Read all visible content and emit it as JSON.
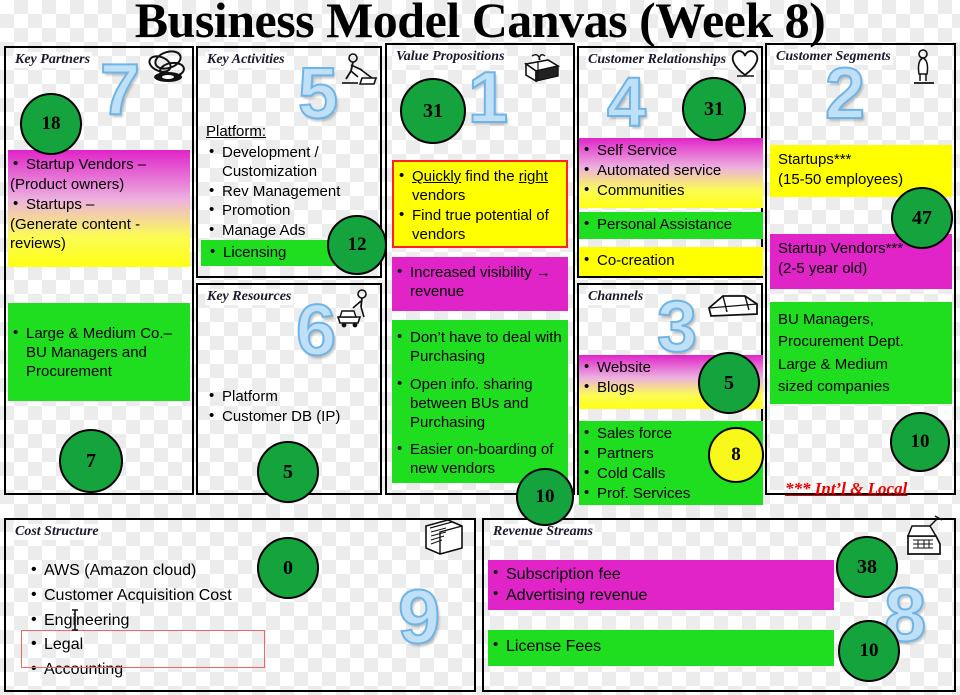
{
  "page": {
    "title": "Business Model Canvas (Week 8)"
  },
  "palette": {
    "green_note": "#1fdd1f",
    "yellow_note": "#ffff00",
    "magenta_note": "#e024c8",
    "bubble_green": "#14a33c",
    "bubble_yellow": "#f7f719",
    "step_number": "#bfe0f7",
    "step_number_outline": "#6fb4e8",
    "annotation_red": "#ff2020",
    "footnote_red": "#ee0000"
  },
  "blocks": {
    "key_partners": {
      "title": "Key Partners",
      "step": "7",
      "icon": "chain-links-icon",
      "bubbles": [
        "18",
        "7"
      ],
      "notes": [
        {
          "style": "gradient-magenta-yellow",
          "items": [
            "Startup Vendors –",
            "(Product owners)",
            "Startups –",
            "(Generate content - reviews)"
          ]
        },
        {
          "style": "green",
          "items": [
            "Large & Medium Co.– BU Managers and Procurement"
          ]
        }
      ]
    },
    "key_activities": {
      "title": "Key Activities",
      "step": "5",
      "icon": "worker-sweeping-icon",
      "bubbles": [
        "12"
      ],
      "heading": "Platform:",
      "items": [
        "Development / Customization",
        "Rev Management",
        "Promotion",
        "Manage Ads",
        "Licensing"
      ],
      "highlighted_item": "Licensing"
    },
    "key_resources": {
      "title": "Key Resources",
      "step": "6",
      "icon": "worker-cart-icon",
      "bubbles": [
        "5"
      ],
      "items": [
        "Platform",
        "Customer DB (IP)"
      ]
    },
    "value_propositions": {
      "title": "Value Propositions",
      "step": "1",
      "icon": "gift-box-icon",
      "bubbles": [
        "31",
        "10"
      ],
      "notes": [
        {
          "style": "yellow-red-outline",
          "items": [
            "Quickly find the right vendors",
            "Find true potential of vendors"
          ],
          "underlined": [
            "Quickly",
            "right"
          ]
        },
        {
          "style": "magenta",
          "items": [
            "Increased visibility → revenue"
          ]
        },
        {
          "style": "green",
          "items": [
            "Don’t have to deal with Purchasing",
            "Open info. sharing between BUs and Purchasing",
            "Easier on-boarding of new vendors"
          ]
        }
      ]
    },
    "customer_relationships": {
      "title": "Customer Relationships",
      "step": "4",
      "icon": "heart-icon",
      "bubbles": [
        "31"
      ],
      "notes": [
        {
          "style": "gradient-magenta-yellow",
          "items": [
            "Self Service",
            "Automated service",
            "Communities"
          ]
        },
        {
          "style": "green",
          "items": [
            "Personal Assistance"
          ]
        },
        {
          "style": "yellow",
          "items": [
            "Co-creation"
          ]
        }
      ]
    },
    "channels": {
      "title": "Channels",
      "step": "3",
      "icon": "delivery-truck-icon",
      "bubbles": [
        "5",
        "8"
      ],
      "notes": [
        {
          "style": "gradient-magenta-yellow",
          "items": [
            "Website",
            "Blogs"
          ]
        },
        {
          "style": "green",
          "items": [
            "Sales force",
            "Partners",
            "Cold Calls",
            "Prof. Services"
          ]
        }
      ]
    },
    "customer_segments": {
      "title": "Customer Segments",
      "step": "2",
      "icon": "person-standing-icon",
      "bubbles": [
        "47",
        "10"
      ],
      "notes": [
        {
          "style": "yellow",
          "items": [
            "Startups***",
            "(15-50 employees)"
          ]
        },
        {
          "style": "magenta",
          "items": [
            "Startup Vendors***",
            "(2-5 year old)"
          ]
        },
        {
          "style": "green",
          "items": [
            "BU Managers,",
            "Procurement Dept.",
            "Large & Medium",
            "sized companies"
          ]
        }
      ],
      "footnote": "*** Int’l & Local"
    },
    "cost_structure": {
      "title": "Cost Structure",
      "step": "9",
      "icon": "invoice-papers-icon",
      "bubbles": [
        "0"
      ],
      "items": [
        "AWS (Amazon cloud)",
        "Customer Acquisition Cost",
        "Engineering",
        "Legal",
        "Accounting"
      ],
      "annotated_items": [
        "Legal",
        "Accounting"
      ]
    },
    "revenue_streams": {
      "title": "Revenue Streams",
      "step": "8",
      "icon": "cash-register-icon",
      "bubbles": [
        "38",
        "10"
      ],
      "notes": [
        {
          "style": "magenta",
          "items": [
            "Subscription fee",
            "Advertising revenue"
          ]
        },
        {
          "style": "green",
          "items": [
            "License Fees"
          ]
        }
      ]
    }
  }
}
